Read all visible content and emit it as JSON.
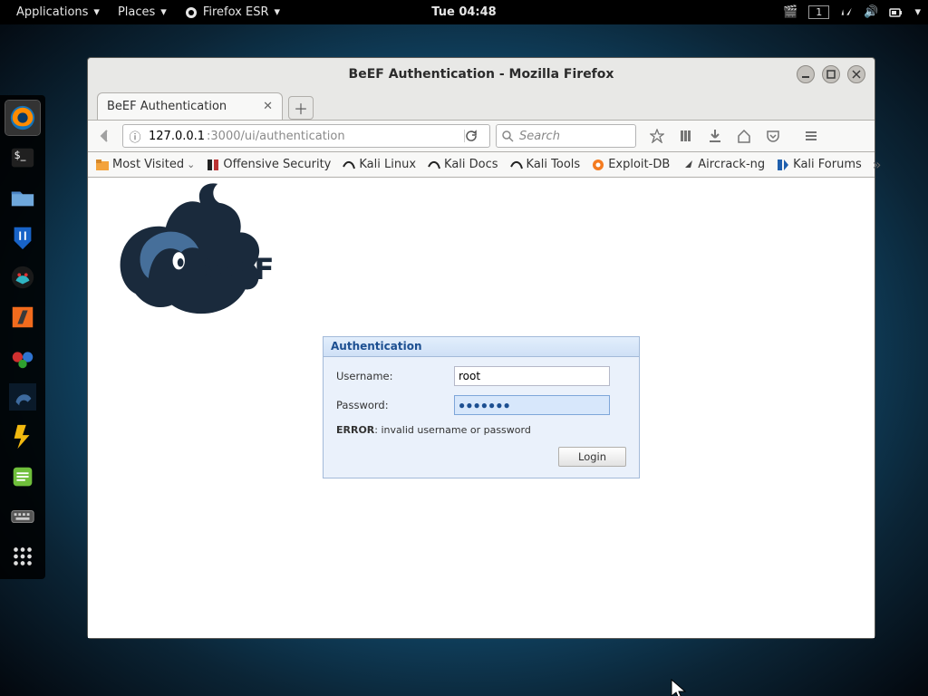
{
  "topbar": {
    "applications": "Applications",
    "places": "Places",
    "app_name": "Firefox ESR",
    "clock": "Tue 04:48",
    "workspace": "1"
  },
  "dock": {
    "items": [
      "firefox",
      "terminal",
      "files",
      "metasploit",
      "armitage",
      "burpsuite",
      "recorder",
      "beef",
      "faraday",
      "notes",
      "keyboard",
      "apps"
    ]
  },
  "window": {
    "title": "BeEF Authentication - Mozilla Firefox",
    "tab_title": "BeEF Authentication",
    "url_host": "127.0.0.1",
    "url_rest": ":3000/ui/authentication",
    "search_placeholder": "Search"
  },
  "bookmarks": {
    "most_visited": "Most Visited",
    "items": [
      "Offensive Security",
      "Kali Linux",
      "Kali Docs",
      "Kali Tools",
      "Exploit-DB",
      "Aircrack-ng",
      "Kali Forums"
    ]
  },
  "auth": {
    "panel_title": "Authentication",
    "username_label": "Username:",
    "password_label": "Password:",
    "username_value": "root",
    "password_dots": "●●●●●●●",
    "error_bold": "ERROR",
    "error_rest": ": invalid username or password",
    "login_label": "Login"
  },
  "beef_text": "BeEF"
}
